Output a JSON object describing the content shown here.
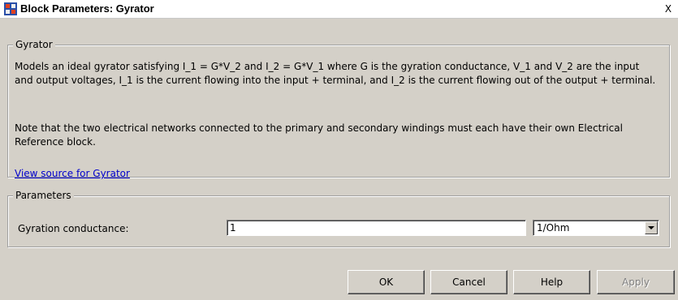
{
  "window": {
    "title": "Block Parameters: Gyrator",
    "icon": "simulink-block-icon",
    "close_label": "X"
  },
  "description": {
    "group_title": "Gyrator",
    "paragraph1": "Models an ideal gyrator satisfying I_1 = G*V_2 and I_2 = G*V_1 where G is the gyration conductance, V_1 and V_2 are the input and output voltages, I_1 is the current flowing into the input + terminal, and I_2 is the current flowing out of the output + terminal.",
    "paragraph2": "Note that the two electrical networks connected to the primary and secondary windings must each have their own Electrical Reference block.",
    "link_label": "View source for Gyrator"
  },
  "parameters": {
    "group_title": "Parameters",
    "label": "Gyration conductance:",
    "value": "1",
    "unit": "1/Ohm"
  },
  "buttons": {
    "ok": "OK",
    "cancel": "Cancel",
    "help": "Help",
    "apply": "Apply"
  }
}
